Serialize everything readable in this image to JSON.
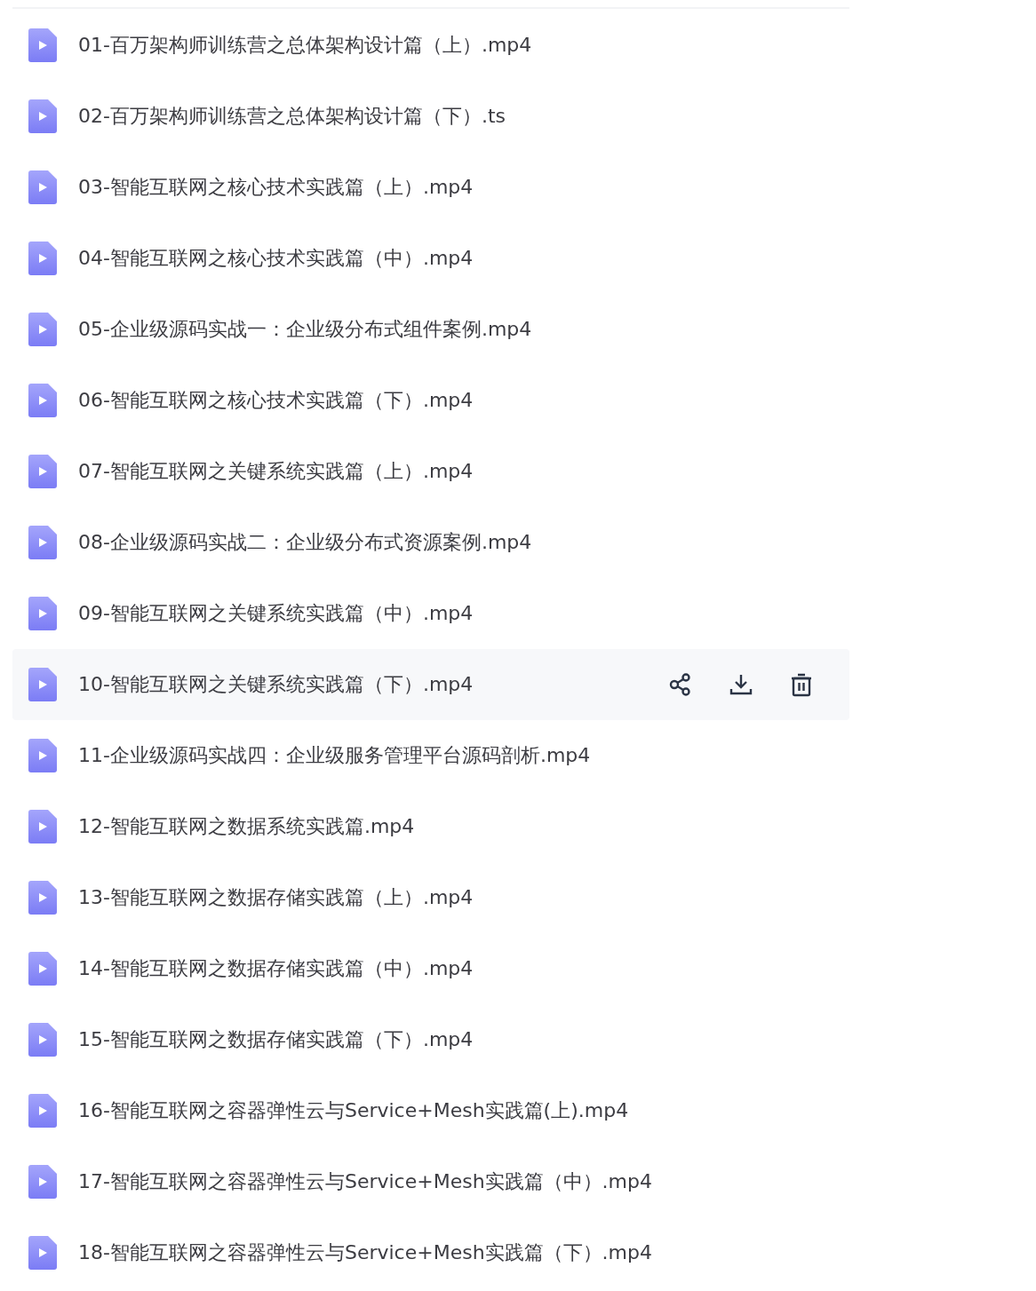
{
  "files": [
    {
      "name": "01-百万架构师训练营之总体架构设计篇（上）.mp4",
      "hovered": false
    },
    {
      "name": "02-百万架构师训练营之总体架构设计篇（下）.ts",
      "hovered": false
    },
    {
      "name": "03-智能互联网之核心技术实践篇（上）.mp4",
      "hovered": false
    },
    {
      "name": "04-智能互联网之核心技术实践篇（中）.mp4",
      "hovered": false
    },
    {
      "name": "05-企业级源码实战一：企业级分布式组件案例.mp4",
      "hovered": false
    },
    {
      "name": "06-智能互联网之核心技术实践篇（下）.mp4",
      "hovered": false
    },
    {
      "name": "07-智能互联网之关键系统实践篇（上）.mp4",
      "hovered": false
    },
    {
      "name": "08-企业级源码实战二：企业级分布式资源案例.mp4",
      "hovered": false
    },
    {
      "name": "09-智能互联网之关键系统实践篇（中）.mp4",
      "hovered": false
    },
    {
      "name": "10-智能互联网之关键系统实践篇（下）.mp4",
      "hovered": true
    },
    {
      "name": "11-企业级源码实战四：企业级服务管理平台源码剖析.mp4",
      "hovered": false
    },
    {
      "name": "12-智能互联网之数据系统实践篇.mp4",
      "hovered": false
    },
    {
      "name": "13-智能互联网之数据存储实践篇（上）.mp4",
      "hovered": false
    },
    {
      "name": "14-智能互联网之数据存储实践篇（中）.mp4",
      "hovered": false
    },
    {
      "name": "15-智能互联网之数据存储实践篇（下）.mp4",
      "hovered": false
    },
    {
      "name": "16-智能互联网之容器弹性云与Service+Mesh实践篇(上).mp4",
      "hovered": false
    },
    {
      "name": "17-智能互联网之容器弹性云与Service+Mesh实践篇（中）.mp4",
      "hovered": false
    },
    {
      "name": "18-智能互联网之容器弹性云与Service+Mesh实践篇（下）.mp4",
      "hovered": false
    }
  ]
}
